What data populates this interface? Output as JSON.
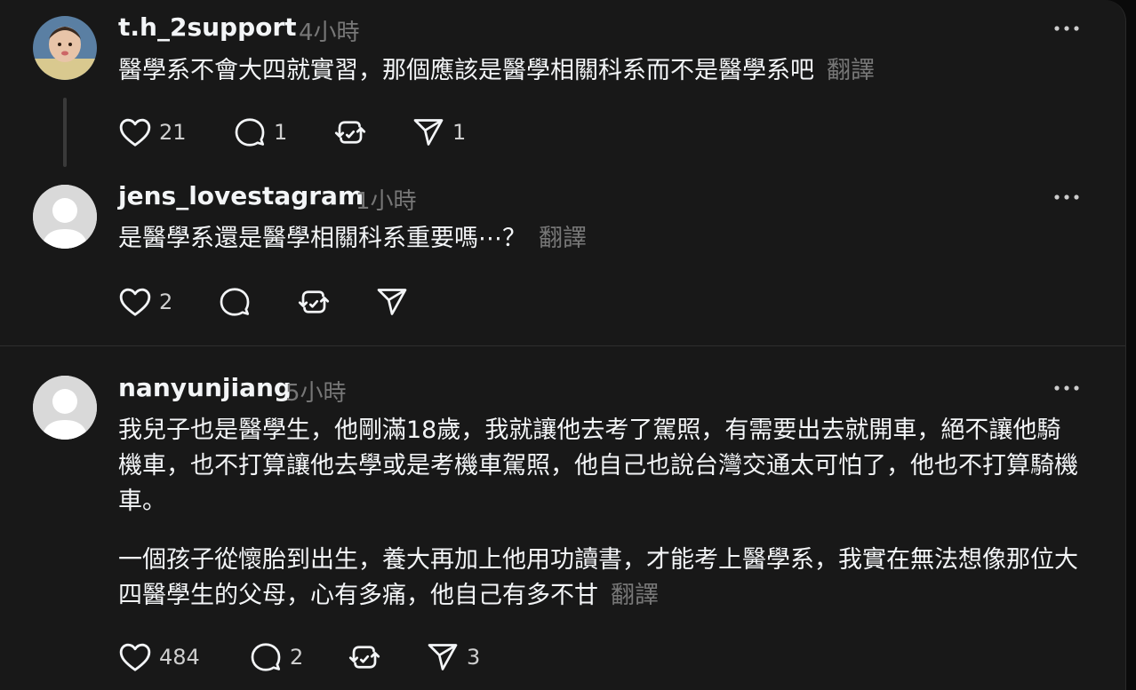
{
  "posts": [
    {
      "username": "t.h_2support",
      "time": "4小時",
      "text": "醫學系不會大四就實習，那個應該是醫學相關科系而不是醫學系吧",
      "translate": "翻譯",
      "likes": "21",
      "comments": "1",
      "reposts": "",
      "shares": "1"
    },
    {
      "username": "jens_lovestagram",
      "time": "1小時",
      "text": "是醫學系還是醫學相關科系重要嗎⋯？",
      "translate": "翻譯",
      "likes": "2",
      "comments": "",
      "reposts": "",
      "shares": ""
    },
    {
      "username": "nanyunjiang",
      "time": "5小時",
      "paragraph1": "我兒子也是醫學生，他剛滿18歲，我就讓他去考了駕照，有需要出去就開車，絕不讓他騎機車，也不打算讓他去學或是考機車駕照，他自己也說台灣交通太可怕了，他也不打算騎機車。",
      "paragraph2": "一個孩子從懷胎到出生，養大再加上他用功讀書，才能考上醫學系，我實在無法想像那位大四醫學生的父母，心有多痛，他自己有多不甘",
      "translate": "翻譯",
      "likes": "484",
      "comments": "2",
      "reposts": "",
      "shares": "3"
    }
  ],
  "icons": {
    "like": "heart-icon",
    "comment": "comment-bubble-icon",
    "repost": "repost-icon",
    "share": "send-icon",
    "more": "more-dots-icon"
  },
  "colors": {
    "background": "#181818",
    "text": "#f3f5f7",
    "muted": "#777777"
  }
}
